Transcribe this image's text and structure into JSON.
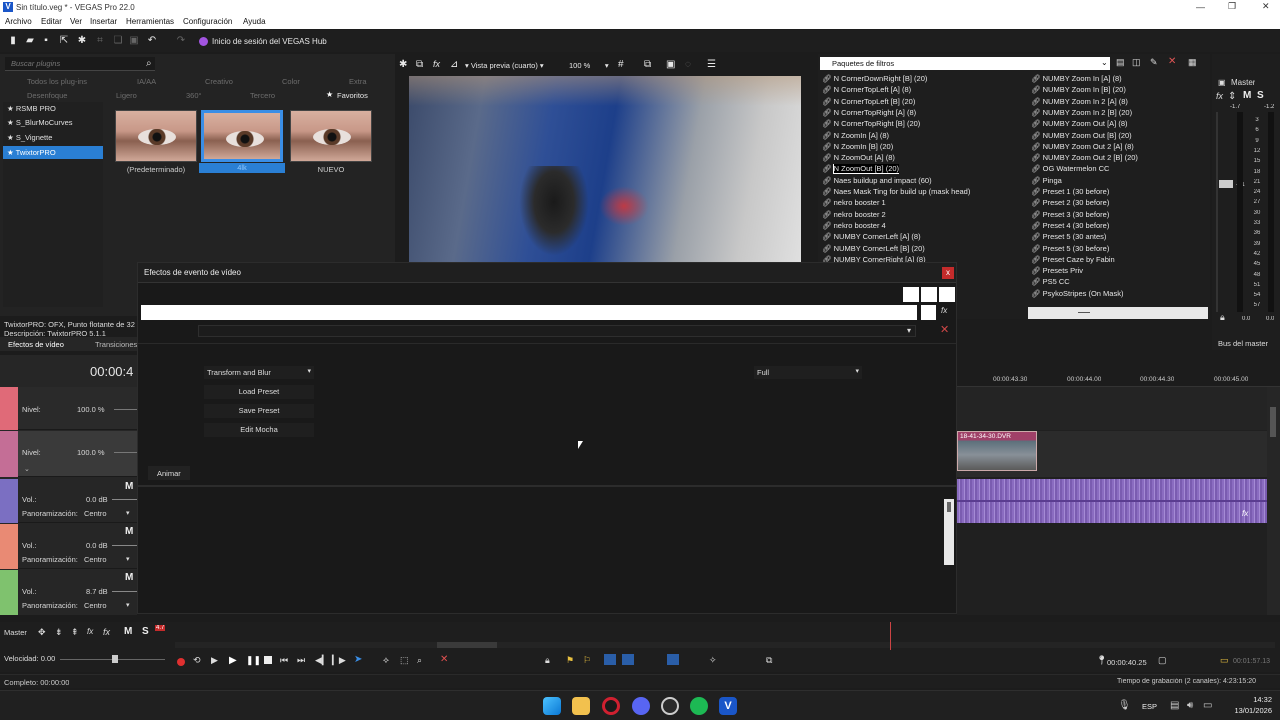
{
  "app": {
    "title": "Sin título.veg * - VEGAS Pro 22.0",
    "menu": [
      "Archivo",
      "Editar",
      "Ver",
      "Insertar",
      "Herramientas",
      "Configuración",
      "Ayuda"
    ],
    "hub_label": "Inicio de sesión del VEGAS Hub"
  },
  "plugins": {
    "search_placeholder": "Buscar plugins",
    "categories_row1": [
      "Todos los plug-ins",
      "IA/AA",
      "Creativo",
      "Color",
      "Extra"
    ],
    "categories_row2": [
      "Desenfoque",
      "Ligero",
      "360°",
      "Tercero",
      "Favoritos"
    ],
    "favorites": [
      "RSMB PRO",
      "S_BlurMoCurves",
      "S_Vignette",
      "TwixtorPRO"
    ],
    "presets": [
      "(Predeterminado)",
      "4lk",
      "NUEVO"
    ],
    "info_line1": "TwixtorPRO: OFX, Punto flotante de 32 b",
    "info_line2": "Descripción: TwixtorPRO 5.1.1",
    "tabs": [
      "Efectos de vídeo",
      "Transiciones"
    ]
  },
  "preview": {
    "mode": "Vista previa (cuarto)",
    "zoom": "100 %"
  },
  "filters": {
    "header": "Paquetes de filtros",
    "col1": [
      "N CornerDownRight [B] (20)",
      "N CornerTopLeft [A] (8)",
      "N CornerTopLeft [B] (20)",
      "N CornerTopRight [A] (8)",
      "N CornerTopRight [B] (20)",
      "N ZoomIn [A] (8)",
      "N ZoomIn [B] (20)",
      "N ZoomOut [A] (8)",
      "N ZoomOut [B] (20)",
      "Naes buildup and impact (60)",
      "Naes Mask Ting for build up (mask head)",
      "nekro booster 1",
      "nekro booster 2",
      "nekro booster 4",
      "NUMBY CornerLeft [A] (8)",
      "NUMBY CornerLeft [B] (20)",
      "NUMBY CornerRight [A] (8)"
    ],
    "col2": [
      "NUMBY Zoom In [A] (8)",
      "NUMBY Zoom In [B] (20)",
      "NUMBY Zoom In 2 [A] (8)",
      "NUMBY Zoom In 2 [B] (20)",
      "NUMBY Zoom Out [A] (8)",
      "NUMBY Zoom Out [B] (20)",
      "NUMBY Zoom Out 2 [A] (8)",
      "NUMBY Zoom Out 2 [B] (20)",
      "OG Watermelon CC",
      "Pinga",
      "Preset 1 (30 before)",
      "Preset 2 (30 before)",
      "Preset 3 (30 before)",
      "Preset 4 (30 before)",
      "Preset 5 (30 antes)",
      "Preset 5 (30 before)",
      "Preset Caze by Fabin",
      "Presets Priv",
      "PS5 CC",
      "PsykoStripes (On Mask)"
    ]
  },
  "master": {
    "label": "Master",
    "bus_label": "Bus del master",
    "peak_left": "-1.7",
    "peak_right": "-1.2",
    "fader_value": "-21",
    "scale": [
      "3",
      "6",
      "9",
      "12",
      "15",
      "18",
      "21",
      "24",
      "27",
      "30",
      "33",
      "36",
      "39",
      "42",
      "45",
      "48",
      "51",
      "54",
      "57"
    ],
    "bottom_left": "0.0",
    "bottom_right": "0.0"
  },
  "dialog": {
    "title": "Efectos de evento de vídeo",
    "dropdown_left": "Transform and Blur",
    "dropdown_right": "Full",
    "buttons": [
      "Load Preset",
      "Save Preset",
      "Edit Mocha"
    ],
    "animate": "Animar"
  },
  "tracks": {
    "time": "00:00:4",
    "video": [
      {
        "label": "Nivel:",
        "value": "100.0 %",
        "color": "#e06a78"
      },
      {
        "label": "Nivel:",
        "value": "100.0 %",
        "color": "#c46e96"
      }
    ],
    "audio": [
      {
        "vol_label": "Vol.:",
        "vol": "0.0 dB",
        "pan_label": "Panoramización:",
        "pan": "Centro",
        "color": "#7b6fc2"
      },
      {
        "vol_label": "Vol.:",
        "vol": "0.0 dB",
        "pan_label": "Panoramización:",
        "pan": "Centro",
        "color": "#e98a74"
      },
      {
        "vol_label": "Vol.:",
        "vol": "8.7 dB",
        "pan_label": "Panoramización:",
        "pan": "Centro",
        "color": "#7fc26e"
      }
    ],
    "mute": "M",
    "ruler": [
      "00:00:43.30",
      "00:00:44.00",
      "00:00:44.30",
      "00:00:45.00"
    ],
    "clip_name": "18-41-34-30.DVR",
    "fx": "fx"
  },
  "bottom": {
    "master": "Master",
    "master_badge": "4.7",
    "speed": "Velocidad: 0.00",
    "cursor_time": "00:00:40.25",
    "end_time": "00:01:57.13"
  },
  "status": {
    "complete": "Completo: 00:00:00",
    "record": "Tiempo de grabación (2 canales): 4:23:15:20"
  },
  "taskbar": {
    "lang": "ESP",
    "time": "14:32",
    "date": "13/01/2026"
  }
}
